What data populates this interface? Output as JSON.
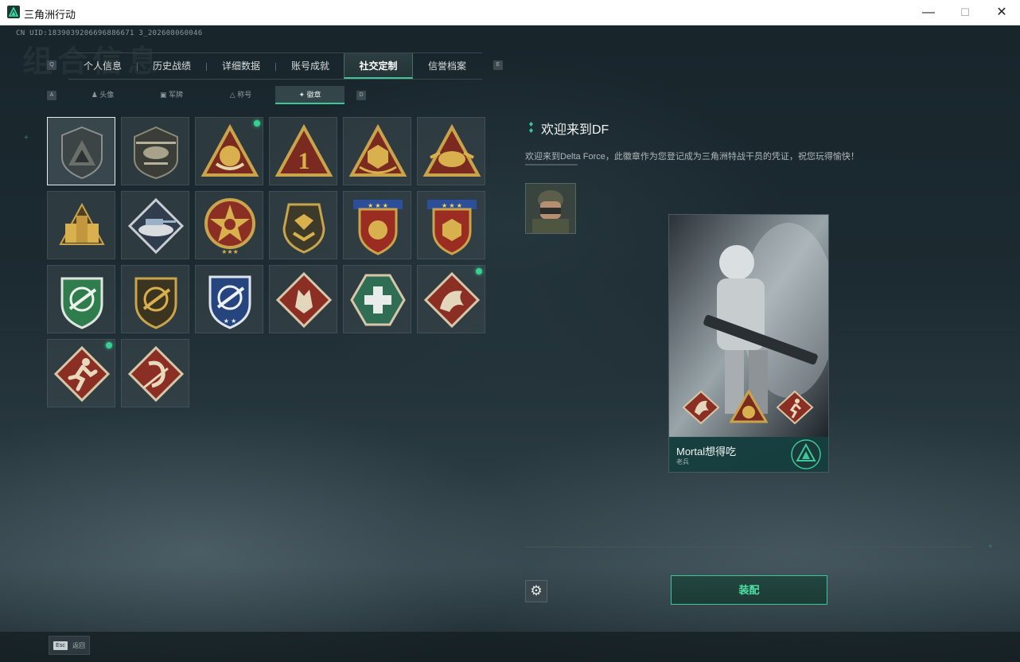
{
  "window": {
    "title": "三角洲行动",
    "minimize": "—",
    "maximize": "☐",
    "close": "✕"
  },
  "uid": "CN UID:1839039206696886671 3_202608060046",
  "background_title": "组合信息",
  "keys": {
    "prev_tab": "Q",
    "next_tab": "E",
    "prev_sub": "A",
    "next_sub": "D"
  },
  "tabs": [
    {
      "label": "个人信息",
      "active": false
    },
    {
      "label": "历史战绩",
      "active": false
    },
    {
      "label": "详细数据",
      "active": false
    },
    {
      "label": "账号成就",
      "active": false
    },
    {
      "label": "社交定制",
      "active": true
    },
    {
      "label": "信誉档案",
      "active": false
    }
  ],
  "subtabs": [
    {
      "label": "头像",
      "icon": "person-icon"
    },
    {
      "label": "军牌",
      "icon": "dogtag-icon"
    },
    {
      "label": "称号",
      "icon": "triangle-icon"
    },
    {
      "label": "徽章",
      "icon": "badge-icon",
      "active": true
    }
  ],
  "badges": [
    {
      "name": "df-default",
      "selected": true,
      "new": false
    },
    {
      "name": "helicopter",
      "new": false
    },
    {
      "name": "gold-flower",
      "new": true
    },
    {
      "name": "number-one",
      "new": false
    },
    {
      "name": "gold-d20",
      "new": false
    },
    {
      "name": "gold-rhino",
      "new": false
    },
    {
      "name": "gold-mechs",
      "new": false
    },
    {
      "name": "tank",
      "new": false
    },
    {
      "name": "star-medal",
      "new": false
    },
    {
      "name": "shield-chevron",
      "new": false
    },
    {
      "name": "red-shield-stars",
      "new": false
    },
    {
      "name": "red-d20-stars",
      "new": false
    },
    {
      "name": "green-crosshair-rifle",
      "new": false
    },
    {
      "name": "bronze-rifle",
      "new": false
    },
    {
      "name": "blue-crosshair",
      "new": false
    },
    {
      "name": "wolf",
      "new": false
    },
    {
      "name": "medic",
      "new": false
    },
    {
      "name": "dragon",
      "new": true
    },
    {
      "name": "runner",
      "new": true
    },
    {
      "name": "red-hook",
      "new": false
    }
  ],
  "detail": {
    "title": "欢迎来到DF",
    "description": "欢迎来到Delta Force，此徽章作为您登记成为三角洲特战干员的凭证，祝您玩得愉快！"
  },
  "card": {
    "player_name": "Mortal想得吃",
    "rank": "老兵"
  },
  "equip_label": "装配",
  "esc": {
    "key": "Esc",
    "label": "返回"
  },
  "colors": {
    "accent": "#3fc59a",
    "new_dot": "#36d08f",
    "gold": "#c9a44a",
    "red": "#8b2e24",
    "green": "#2f7d4c"
  }
}
